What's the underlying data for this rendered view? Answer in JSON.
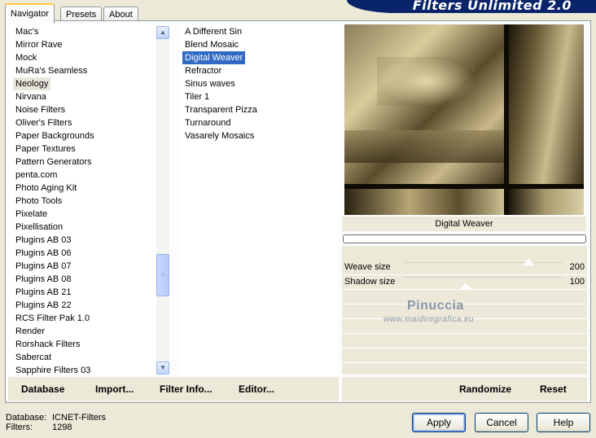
{
  "tabs": [
    "Navigator",
    "Presets",
    "About"
  ],
  "banner_title": "Filters Unlimited 2.0",
  "categories": [
    "Mac's",
    "Mirror Rave",
    "Mock",
    "MuRa's Seamless",
    "Neology",
    "Nirvana",
    "Noise Filters",
    "Oliver's Filters",
    "Paper Backgrounds",
    "Paper Textures",
    "Pattern Generators",
    "penta.com",
    "Photo Aging Kit",
    "Photo Tools",
    "Pixelate",
    "Pixellisation",
    "Plugins AB 03",
    "Plugins AB 06",
    "Plugins AB 07",
    "Plugins AB 08",
    "Plugins AB 21",
    "Plugins AB 22",
    "RCS Filter Pak 1.0",
    "Render",
    "Rorshack Filters",
    "Sabercat",
    "Sapphire Filters 03"
  ],
  "highlighted_category": "Neology",
  "filters": [
    "A Different Sin",
    "Blend Mosaic",
    "Digital Weaver",
    "Refractor",
    "Sinus waves",
    "Tiler 1",
    "Transparent Pizza",
    "Turnaround",
    "Vasarely Mosaics"
  ],
  "selected_filter": "Digital Weaver",
  "filter_name": "Digital Weaver",
  "progress": 0,
  "sliders": [
    {
      "label": "Weave size",
      "value": "200",
      "max": 255
    },
    {
      "label": "Shadow size",
      "value": "100",
      "max": 255
    }
  ],
  "left_buttons": {
    "database": "Database",
    "import": "Import...",
    "filter_info": "Filter Info...",
    "editor": "Editor..."
  },
  "right_buttons": {
    "randomize": "Randomize",
    "reset": "Reset"
  },
  "watermark": {
    "name": "Pinuccia",
    "url": "www.maidiregrafica.eu"
  },
  "status": {
    "database_label": "Database:",
    "database_value": "ICNET-Filters",
    "filters_label": "Filters:",
    "filters_value": "1298"
  },
  "dialog_buttons": {
    "apply": "Apply",
    "cancel": "Cancel",
    "help": "Help"
  },
  "scroll_icons": {
    "up": "scroll-up-icon",
    "down": "scroll-down-icon"
  },
  "colors": {
    "selection": "#316ac5",
    "banner": "#0a246a",
    "panel": "#ece9d8"
  }
}
